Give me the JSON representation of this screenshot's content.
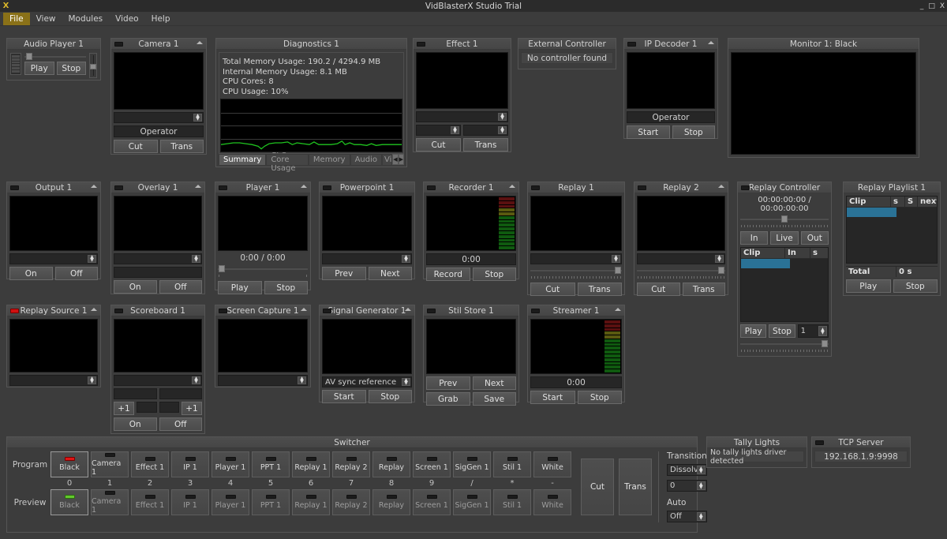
{
  "window": {
    "title": "VidBlasterX Studio Trial",
    "logo": "X",
    "minimize": "_",
    "maximize": "□",
    "close": "X"
  },
  "menu": [
    {
      "label": "File",
      "active": true
    },
    {
      "label": "View",
      "active": false
    },
    {
      "label": "Modules",
      "active": false
    },
    {
      "label": "Video",
      "active": false
    },
    {
      "label": "Help",
      "active": false
    }
  ],
  "audio_player": {
    "title": "Audio Player 1",
    "play": "Play",
    "stop": "Stop"
  },
  "camera": {
    "title": "Camera 1",
    "source": "",
    "operator": "Operator",
    "cut": "Cut",
    "trans": "Trans"
  },
  "diagnostics": {
    "title": "Diagnostics 1",
    "total_memory": "Total Memory Usage: 190.2 / 4294.9 MB",
    "internal_memory": "Internal Memory Usage: 8.1 MB",
    "cpu_cores": "CPU Cores: 8",
    "cpu_usage": "CPU Usage: 10%",
    "tabs": [
      {
        "label": "Summary",
        "selected": true
      },
      {
        "label": "CPU Core Usage",
        "selected": false
      },
      {
        "label": "Memory",
        "selected": false
      },
      {
        "label": "Audio",
        "selected": false
      },
      {
        "label": "Vid",
        "selected": false
      }
    ],
    "arrow_left": "◀",
    "arrow_right": "▶",
    "graph_color": "#1fc41f"
  },
  "effect": {
    "title": "Effect 1",
    "source": "",
    "param_a": "",
    "param_b": "",
    "cut": "Cut",
    "trans": "Trans"
  },
  "external_controller": {
    "title": "External Controller",
    "message": "No controller found"
  },
  "ip_decoder": {
    "title": "IP Decoder 1",
    "operator": "Operator",
    "start": "Start",
    "stop": "Stop"
  },
  "monitor": {
    "title": "Monitor 1: Black"
  },
  "output": {
    "title": "Output 1",
    "source": "",
    "on": "On",
    "off": "Off"
  },
  "overlay": {
    "title": "Overlay 1",
    "source": "",
    "field": "",
    "on": "On",
    "off": "Off"
  },
  "player": {
    "title": "Player 1",
    "time": "0:00 / 0:00",
    "play": "Play",
    "stop": "Stop"
  },
  "powerpoint": {
    "title": "Powerpoint 1",
    "source": "",
    "prev": "Prev",
    "next": "Next"
  },
  "recorder": {
    "title": "Recorder 1",
    "time": "0:00",
    "record": "Record",
    "stop": "Stop"
  },
  "replay1": {
    "title": "Replay 1",
    "source": "",
    "cut": "Cut",
    "trans": "Trans"
  },
  "replay2": {
    "title": "Replay 2",
    "source": "",
    "cut": "Cut",
    "trans": "Trans"
  },
  "replay_controller": {
    "title": "Replay Controller",
    "timecode": "00:00:00:00 / 00:00:00:00",
    "in": "In",
    "live": "Live",
    "out": "Out",
    "columns": [
      "Clip",
      "In",
      "s"
    ],
    "play": "Play",
    "stop": "Stop",
    "speed": "1"
  },
  "replay_playlist": {
    "title": "Replay Playlist 1",
    "columns": [
      "Clip",
      "s",
      "S",
      "next"
    ],
    "total_label": "Total",
    "total_value": "0 s",
    "play": "Play",
    "stop": "Stop"
  },
  "replay_source": {
    "title": "Replay Source 1",
    "source": ""
  },
  "scoreboard": {
    "title": "Scoreboard 1",
    "source": "",
    "team_a": "",
    "team_b": "",
    "plus_left": "+1",
    "plus_right": "+1",
    "score_a": "",
    "score_b": "",
    "on": "On",
    "off": "Off"
  },
  "screen_capture": {
    "title": "Screen Capture 1",
    "source": ""
  },
  "signal_generator": {
    "title": "Signal Generator 1",
    "mode": "AV sync reference",
    "start": "Start",
    "stop": "Stop"
  },
  "still_store": {
    "title": "Stil Store 1",
    "prev": "Prev",
    "next": "Next",
    "grab": "Grab",
    "save": "Save"
  },
  "streamer": {
    "title": "Streamer 1",
    "time": "0:00",
    "start": "Start",
    "stop": "Stop"
  },
  "switcher": {
    "title": "Switcher",
    "program_label": "Program",
    "preview_label": "Preview",
    "sources": [
      {
        "label": "Black",
        "key": "0"
      },
      {
        "label": "Camera 1",
        "key": "1"
      },
      {
        "label": "Effect 1",
        "key": "2"
      },
      {
        "label": "IP 1",
        "key": "3"
      },
      {
        "label": "Player 1",
        "key": "4"
      },
      {
        "label": "PPT 1",
        "key": "5"
      },
      {
        "label": "Replay 1",
        "key": "6"
      },
      {
        "label": "Replay 2",
        "key": "7"
      },
      {
        "label": "Replay",
        "key": "8"
      },
      {
        "label": "Screen 1",
        "key": "9"
      },
      {
        "label": "SigGen 1",
        "key": "/"
      },
      {
        "label": "Stil 1",
        "key": "*"
      },
      {
        "label": "White",
        "key": "-"
      }
    ],
    "program_active_index": 0,
    "preview_active_index": 0,
    "cut": "Cut",
    "trans": "Trans",
    "transition_label": "Transition",
    "transition_type": "Dissolve",
    "transition_duration": "0",
    "auto_label": "Auto",
    "auto_value": "Off",
    "tally_red": "#e01414",
    "tally_green": "#62c92c"
  },
  "tally_lights": {
    "title": "Tally Lights",
    "message": "No tally lights driver detected"
  },
  "tcp_server": {
    "title": "TCP Server",
    "address": "192.168.1.9:9998"
  }
}
